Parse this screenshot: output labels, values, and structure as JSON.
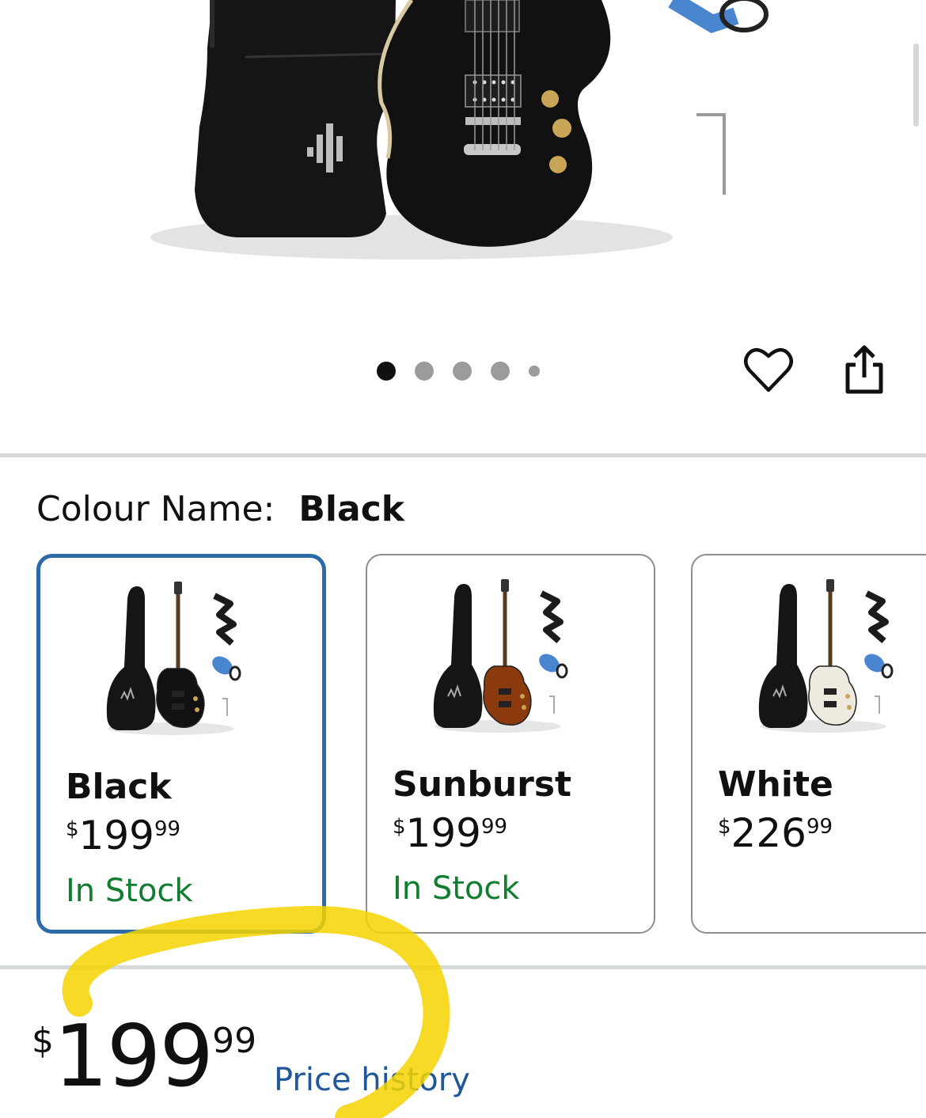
{
  "carousel": {
    "dot_count": 5,
    "active_index": 0
  },
  "icons": {
    "wishlist": "heart-icon",
    "share": "share-icon"
  },
  "variation": {
    "label": "Colour Name:",
    "selected_value": "Black",
    "options": [
      {
        "name": "Black",
        "price_symbol": "$",
        "price_whole": "199",
        "price_fraction": "99",
        "availability": "In Stock",
        "selected": true,
        "body_color": "#111111"
      },
      {
        "name": "Sunburst",
        "price_symbol": "$",
        "price_whole": "199",
        "price_fraction": "99",
        "availability": "In Stock",
        "selected": false,
        "body_color": "#8a3a0c"
      },
      {
        "name": "White",
        "price_symbol": "$",
        "price_whole": "226",
        "price_fraction": "99",
        "availability": "",
        "selected": false,
        "body_color": "#eeeae0"
      }
    ]
  },
  "price": {
    "symbol": "$",
    "whole": "199",
    "fraction": "99",
    "history_link": "Price history"
  },
  "colors": {
    "in_stock": "#127c2f",
    "link": "#20579b",
    "selected_border": "#2d6aa8",
    "highlight_marker": "#f5d400"
  }
}
